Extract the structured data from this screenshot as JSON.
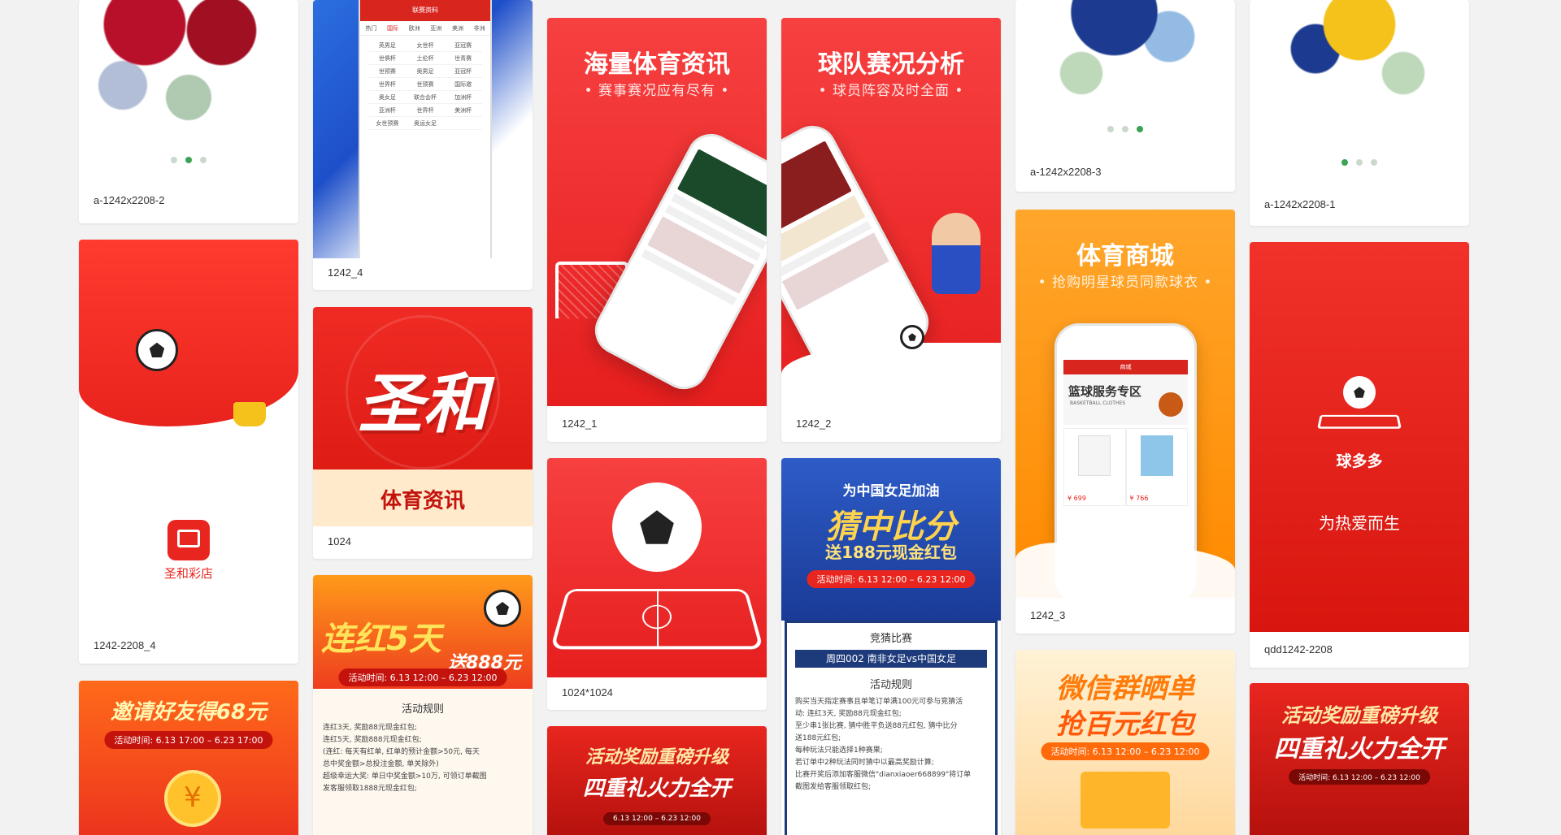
{
  "cards": {
    "c1": {
      "caption": "a-1242x2208-2"
    },
    "c2": {
      "caption": "1242_4",
      "app_header": "联赛资料",
      "tabs": [
        "热门",
        "国际",
        "欧洲",
        "亚洲",
        "美洲",
        "非洲"
      ],
      "rows": [
        [
          "英男足",
          "女世杯",
          "亚冠赛"
        ],
        [
          "世俱杯",
          "土伦杯",
          "世青赛"
        ],
        [
          "世预赛",
          "奥男足",
          "亚冠杯"
        ],
        [
          "世界杯",
          "世预赛",
          "国际邀"
        ],
        [
          "奥女足",
          "联合会杯",
          "加洲杯"
        ],
        [
          "亚洲杯",
          "世界杯",
          "美洲杯"
        ],
        [
          "女世预赛",
          "奥运女足",
          ""
        ]
      ]
    },
    "c3": {
      "caption": "1242_1",
      "title": "海量体育资讯",
      "subtitle": "• 赛事赛况应有尽有 •"
    },
    "c4": {
      "caption": "1242_2",
      "title": "球队赛况分析",
      "subtitle": "• 球员阵容及时全面 •"
    },
    "c5": {
      "caption": "a-1242x2208-3"
    },
    "c6": {
      "caption": "a-1242x2208-1"
    },
    "c7": {
      "caption": "1242-2208_4",
      "app_name": "圣和彩店"
    },
    "c8": {
      "caption": "1024",
      "brand": "圣和",
      "ribbon": "体育资讯"
    },
    "c9": {
      "caption": "1024*1024"
    },
    "c10": {
      "title1": "为中国女足加油",
      "title2": "猜中比分",
      "title3": "送188元现金红包",
      "time": "活动时间: 6.13 12:00 – 6.23 12:00",
      "section1": "竞猜比赛",
      "match": "周四002  南非女足vs中国女足",
      "section2": "活动规则",
      "rules": [
        "购买当天指定赛事且单笔订单满100元可参与竞猜活",
        "动: 连红3天, 奖励88元现金红包;",
        "至少串1张比赛, 猜中胜平负送88元红包, 猜中比分",
        "送188元红包;",
        "每种玩法只能选择1种赛果;",
        "若订单中2种玩法同时猜中以最高奖励计算;",
        "比赛开奖后添加客服微信\"dianxiaoer668899\"将订单",
        "截图发给客服领取红包;"
      ]
    },
    "c11": {
      "caption": "1242_3",
      "title": "体育商城",
      "subtitle": "• 抢购明星球员同款球衣 •",
      "app_header": "商城",
      "zone_title": "篮球服务专区",
      "zone_sub": "BASKETBALL CLOTHES",
      "prices": [
        "¥ 699",
        "¥ 766"
      ]
    },
    "c12": {
      "caption": "qdd1242-2208",
      "app_name": "球多多",
      "slogan": "为热爱而生"
    },
    "c13": {
      "title": "邀请好友得68元",
      "time": "活动时间: 6.13 17:00 – 6.23 17:00"
    },
    "c14": {
      "title1": "连红5天",
      "title2": "送888元",
      "time": "活动时间: 6.13 12:00 – 6.23 12:00",
      "section": "活动规则",
      "rules": [
        "连红3天, 奖励88元现金红包;",
        "连红5天, 奖励888元现金红包;",
        "(连红: 每天有红单, 红单的预计金额>50元, 每天",
        "总中奖金额>总投注金额, 单关除外)",
        "超级幸运大奖: 单日中奖金额>10万, 可领订单截图",
        "发客服领取1888元现金红包;"
      ]
    },
    "c15": {
      "title1": "活动奖励重磅升级",
      "title2": "四重礼火力全开",
      "time": "6.13 12:00 – 6.23 12:00"
    },
    "c16": {
      "title1": "微信群晒单",
      "title2": "抢百元红包",
      "time": "活动时间: 6.13 12:00 – 6.23 12:00"
    },
    "c17": {
      "title1": "活动奖励重磅升级",
      "title2": "四重礼火力全开",
      "time": "活动时间: 6.13 12:00 – 6.23 12:00"
    }
  },
  "colors": {
    "red": "#e8261f",
    "orange": "#ff8f0a",
    "green": "#3aa354",
    "navy": "#1d3a7a"
  }
}
